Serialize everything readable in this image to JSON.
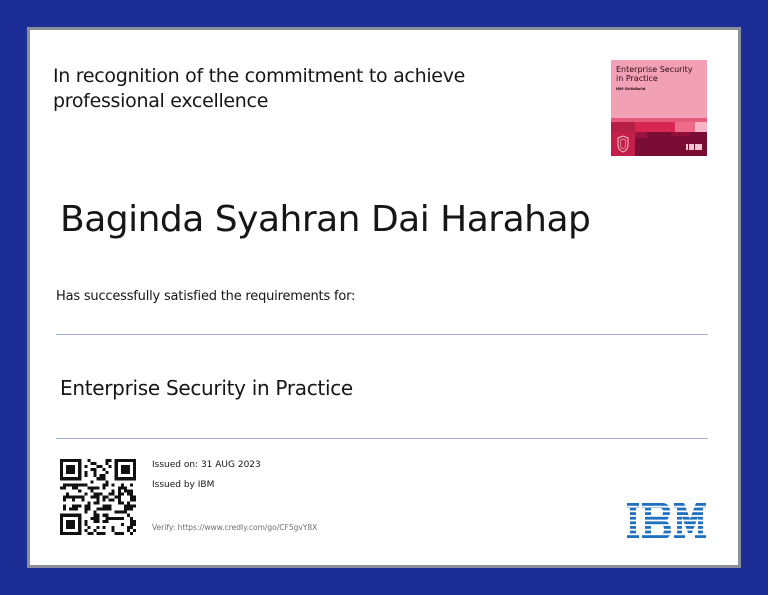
{
  "certificate": {
    "recognition_line1": "In recognition of the commitment to achieve",
    "recognition_line2": "professional excellence",
    "recipient_name": "Baginda Syahran Dai Harahap",
    "satisfied_text": "Has successfully satisfied the requirements for:",
    "course_title": "Enterprise Security in Practice",
    "issued_on": "Issued on: 31 AUG 2023",
    "issued_by": "Issued by IBM",
    "verify": "Verify: https://www.credly.com/go/CF5gvY8X"
  },
  "badge": {
    "title_line1": "Enterprise Security",
    "title_line2": "in Practice",
    "subtitle": "IBM SkillsBuild",
    "brand": "IBM",
    "colors": {
      "background": "#f2a0b5",
      "accent_red": "#d7264f",
      "dark": "#7a0d34",
      "mid": "#b71f47"
    }
  },
  "icons": {
    "qr": "qr-code-icon",
    "shield": "shield-icon",
    "logo": "ibm-logo"
  },
  "colors": {
    "outer_background": "#1c2e95",
    "frame_border": "#8a8f99",
    "paper": "#ffffff",
    "rule": "#a4afe0",
    "ibm_blue": "#1f70c1"
  }
}
